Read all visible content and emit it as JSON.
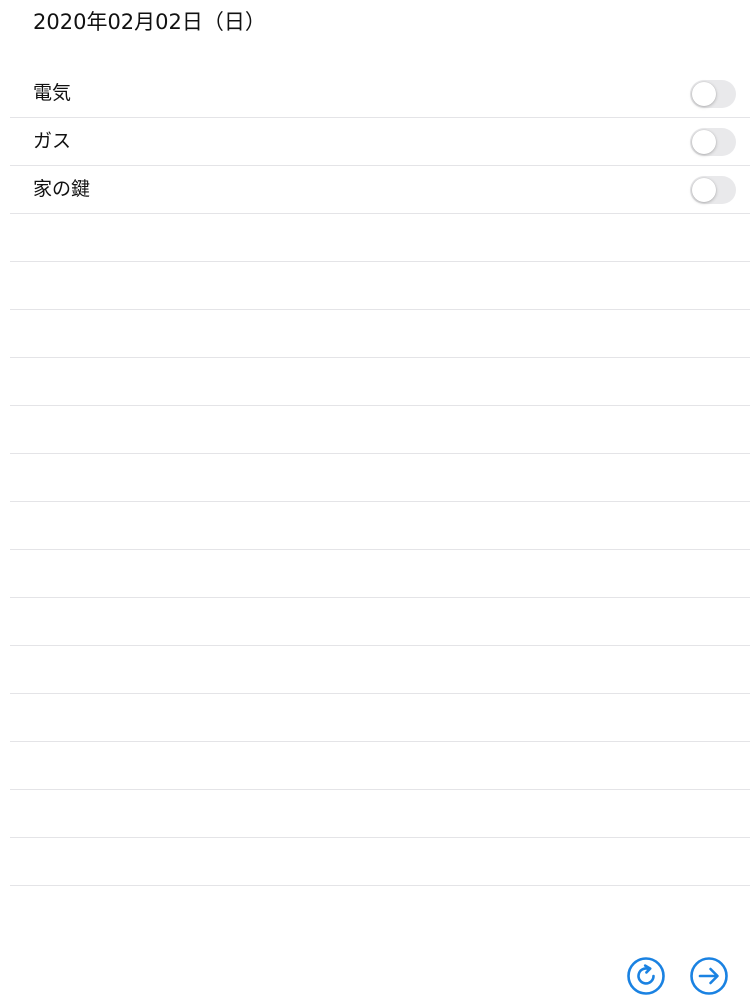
{
  "header": {
    "date": "2020年02月02日（日）"
  },
  "checklist": {
    "items": [
      {
        "label": "電気",
        "on": false
      },
      {
        "label": "ガス",
        "on": false
      },
      {
        "label": "家の鍵",
        "on": false
      }
    ],
    "empty_rows": 14
  },
  "toolbar": {
    "refresh_icon": "refresh-icon",
    "next_icon": "arrow-right-icon",
    "accent_color": "#1a82e2"
  },
  "colors": {
    "separator": "#e4e4e7",
    "toggle_off": "#e9e9eb"
  }
}
